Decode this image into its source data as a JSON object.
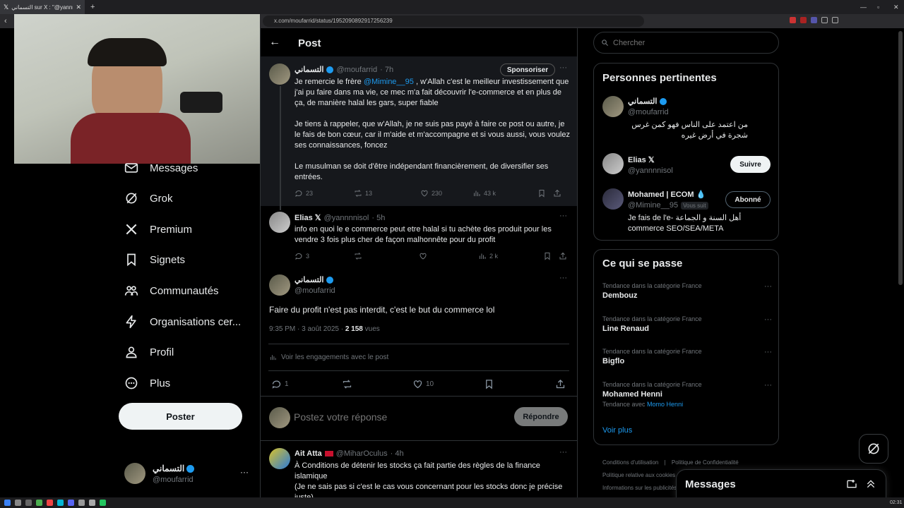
{
  "browser": {
    "tab_title": "التسماني sur X : \"@yannnnisol ...",
    "url": "x.com/moufarrid/status/1952090892917256239"
  },
  "sidebar": {
    "items": [
      {
        "label": "Messages",
        "icon": "mail-icon"
      },
      {
        "label": "Grok",
        "icon": "grok-icon"
      },
      {
        "label": "Premium",
        "icon": "x-logo-icon"
      },
      {
        "label": "Signets",
        "icon": "bookmark-icon"
      },
      {
        "label": "Communautés",
        "icon": "communities-icon"
      },
      {
        "label": "Organisations cer...",
        "icon": "lightning-icon"
      },
      {
        "label": "Profil",
        "icon": "person-icon"
      },
      {
        "label": "Plus",
        "icon": "more-circle-icon"
      }
    ],
    "post_button": "Poster",
    "account": {
      "name": "التسماني",
      "handle": "@moufarrid"
    }
  },
  "header": {
    "title": "Post"
  },
  "thread": [
    {
      "name": "التسماني",
      "handle": "@moufarrid",
      "time": "· 7h",
      "badge": "Sponsoriser",
      "p1_a": "Je remercie le frère ",
      "p1_mention": "@Mimine__95",
      "p1_b": " , w'Allah c'est le meilleur investissement que j'ai pu faire dans ma vie, ce mec m'a fait découvrir l'e-commerce et en plus de ça, de manière halal les gars, super fiable",
      "p2": "Je tiens à rappeler, que w'Allah, je ne suis pas payé à faire ce post ou autre, je le fais de bon cœur, car il m'aide et m'accompagne et si vous aussi, vous voulez ses connaissances, foncez",
      "p3": "Le musulman se doit d'être indépendant financièrement, de diversifier ses entrées.",
      "replies": "23",
      "reposts": "13",
      "likes": "230",
      "views": "43 k"
    },
    {
      "name": "Elias 𝕏",
      "handle": "@yannnnisol",
      "time": "· 5h",
      "text": "info en quoi le e commerce peut etre halal si tu achète des produit pour les vendre 3 fois plus cher de façon malhonnête pour du profit",
      "replies": "3",
      "views": "2 k"
    }
  ],
  "focus": {
    "name": "التسماني",
    "handle": "@moufarrid",
    "text": "Faire du profit n'est pas interdit, c'est le but du commerce lol",
    "time": "9:35 PM · 3 août 2025 · ",
    "views_count": "2 158",
    "views_label": " vues",
    "engagements": "Voir les engagements avec le post",
    "replies": "1",
    "likes": "10"
  },
  "reply_box": {
    "placeholder": "Postez votre réponse",
    "button": "Répondre"
  },
  "reply": {
    "name": "Ait Atta",
    "handle": "@MiharOculus",
    "time": "· 4h",
    "line1": "À Conditions de détenir les stocks ça fait partie des règles de la finance islamique",
    "line2": "(Je ne sais pas si c'est le cas vous concernant pour les stocks donc je précise juste)"
  },
  "search": {
    "placeholder": "Chercher"
  },
  "relevant": {
    "title": "Personnes pertinentes",
    "people": [
      {
        "name": "التسماني",
        "handle": "@moufarrid",
        "bio": "من اعتمد على الناس فهو كمن غرس شجرة في أرض غيره"
      },
      {
        "name": "Elias 𝕏",
        "handle": "@yannnnisol",
        "button": "Suivre"
      },
      {
        "name": "Mohamed | ECOM 💧",
        "handle": "@Mimine__95",
        "follows_you": "Vous suit",
        "button": "Abonné",
        "bio": "Je fais de l'e- أهل السنة و الجماعة commerce SEO/SEA/META"
      }
    ]
  },
  "trends": {
    "title": "Ce qui se passe",
    "items": [
      {
        "category": "Tendance dans la catégorie France",
        "name": "Dembouz"
      },
      {
        "category": "Tendance dans la catégorie France",
        "name": "Line Renaud"
      },
      {
        "category": "Tendance dans la catégorie France",
        "name": "Bigflo"
      },
      {
        "category": "Tendance dans la catégorie France",
        "name": "Mohamed Henni",
        "extra_prefix": "Tendance avec ",
        "extra_link": "Momo Henni"
      }
    ],
    "more": "Voir plus"
  },
  "footer_links": [
    "Conditions d'utilisation",
    "Politique de Confidentialité",
    "Politique relative aux cookies",
    "Informations sur les publicités"
  ],
  "messages_drawer": {
    "title": "Messages"
  },
  "taskbar": {
    "clock": "02:31"
  },
  "colors": {
    "accent": "#1d9bf0",
    "background": "#000000",
    "border": "#2f3336"
  }
}
